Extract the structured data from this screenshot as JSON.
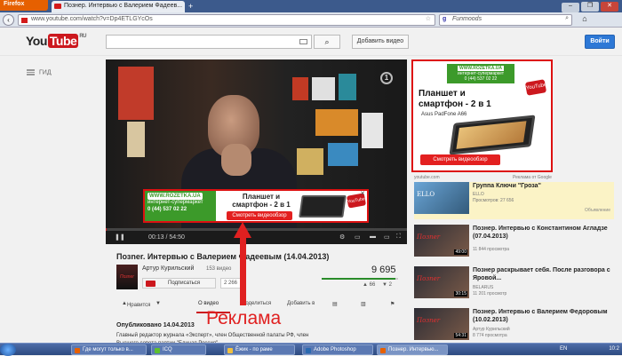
{
  "browser": {
    "menu_button": "Firefox",
    "tab_title": "Познер. Интервью с Валерием Фадеев...",
    "new_tab": "+",
    "url": "www.youtube.com/watch?v=Dp4ETLGYcOs",
    "search_engine_letter": "g",
    "search_value": "Funmoods",
    "window_controls": [
      "–",
      "❐",
      "✕"
    ]
  },
  "youtube": {
    "logo_you": "You",
    "logo_tube": "Tube",
    "logo_region": "RU",
    "search_value": "",
    "upload_label": "Добавить видео",
    "signin_label": "Войти",
    "guide_label": "ГИД"
  },
  "player": {
    "channel_logo": "1",
    "time": "00:13 / 54:50",
    "progress_fraction": 0.004,
    "overlay_ad": {
      "brand": "WWW.ROZETKA.UA",
      "tagline": "интернет-супермаркет",
      "phone": "0 (44) 537 02 22",
      "title": "Планшет и смартфон - 2 в 1",
      "button": "Смотреть видеообзор",
      "yt_badge": "YouTube",
      "close": "✕"
    }
  },
  "side_ad": {
    "brand": "WWW.ROZETKA.UA",
    "tagline": "интернет-супермаркет",
    "phone": "0 (44) 537 02 22",
    "yt_badge": "YouTube",
    "title": "Планшет и смартфон - 2 в 1",
    "model": "Asus PadFone A66",
    "button": "Смотреть видеообзор",
    "footer_left": "youtube.com",
    "footer_right": "Реклама от Google"
  },
  "annotation": {
    "label": "Реклама"
  },
  "video": {
    "title": "Позner. Интервью с Валерием Фадеевым (14.04.2013)",
    "channel": "Артур Курильский",
    "channel_videos": "153 видео",
    "avatar_text": "Позner",
    "subscribe": "Подписаться",
    "subscribers": "2 266",
    "views": "9 695",
    "likes": "66",
    "dislikes": "2",
    "views_like_fraction": 0.97,
    "actions": {
      "like": "Нравится",
      "dislike": "",
      "about": "О видео",
      "share": "Поделиться",
      "add": "Добавить в"
    },
    "published": "Опубликовано 14.04.2013",
    "description": "Главный редактор журнала «Эксперт», член Общественной палаты РФ, член Высшего совета партии \"Единая Россия\""
  },
  "related": [
    {
      "title": "Группа Ключи \"Гроза\"",
      "author": "ELLO",
      "views": "Просмотров: 27 656",
      "badge": "Объявление",
      "thumb_text": "ELLO",
      "duration": ""
    },
    {
      "title": "Познер. Интервью с Константином Агладзе (07.04.2013)",
      "author": "",
      "views": "11 844 просмотра",
      "thumb_text": "Позner",
      "duration": "49:00"
    },
    {
      "title": "Познер раскрывает себя. После разговора с Яровой...",
      "author": "BELARUS",
      "views": "11 201 просмотр",
      "thumb_text": "Позner",
      "duration": "30:15"
    },
    {
      "title": "Познер. Интервью с Валерием Федоровым (10.02.2013)",
      "author": "Артур Курильский",
      "views": "8 774 просмотра",
      "thumb_text": "Позner",
      "duration": "54:31"
    }
  ],
  "taskbar": {
    "tasks": [
      "Где могут только в...",
      "ICQ",
      "Ёжик - по раме",
      "Adobe Photoshop",
      "Познер. Интервью..."
    ],
    "lang": "EN",
    "time": "10:2"
  },
  "colors": {
    "yt_red": "#cc181e",
    "ad_border": "#dd1111",
    "rozetka_green": "#3c9a2a",
    "annotation_red": "#e02020",
    "signin_blue": "#2d78d6"
  }
}
